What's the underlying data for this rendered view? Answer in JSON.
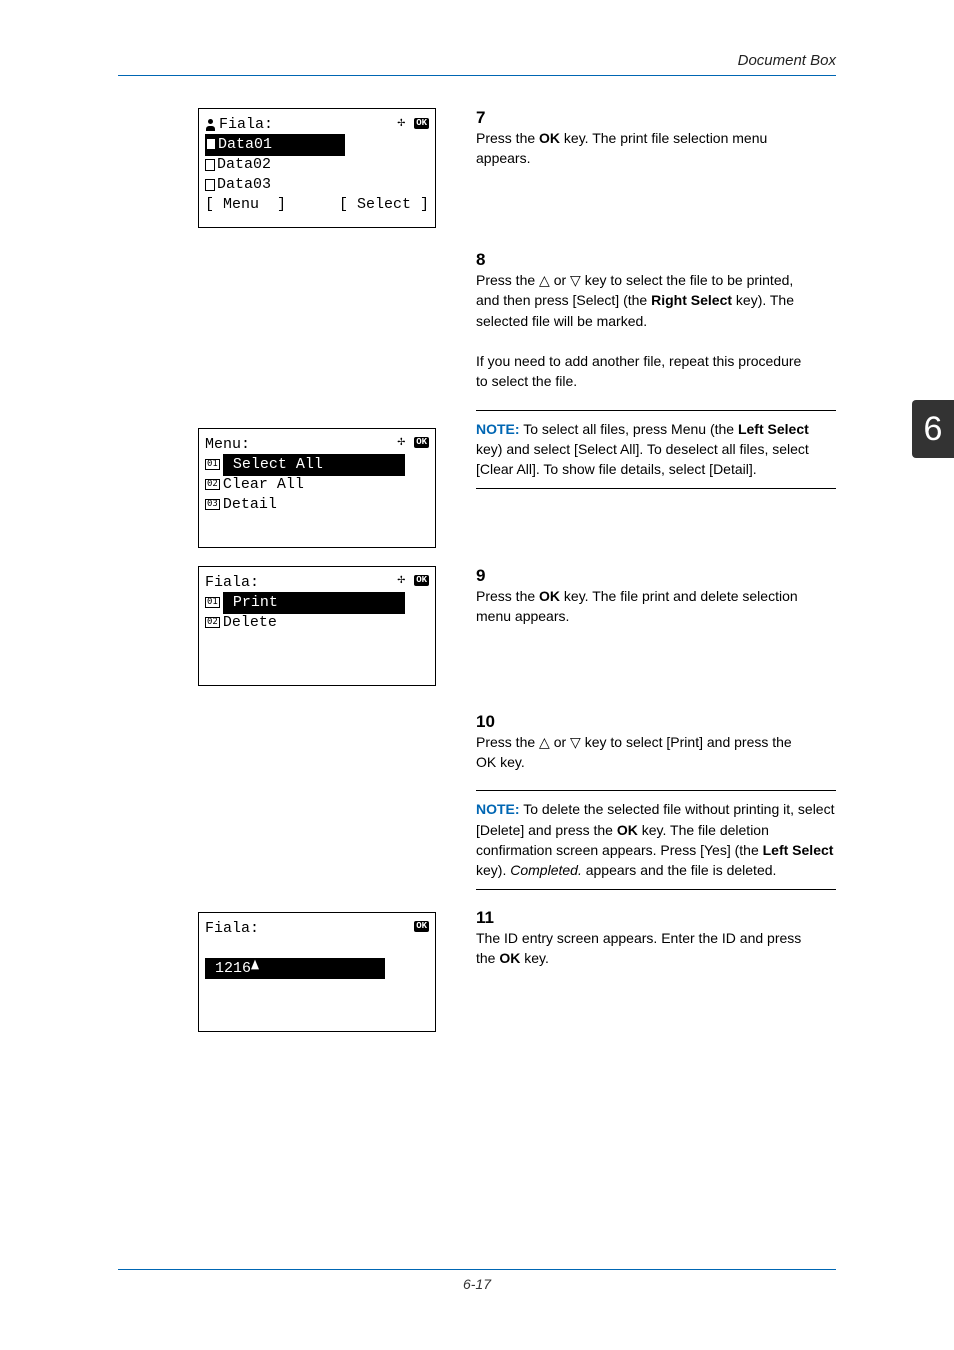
{
  "header": {
    "title": "Document Box"
  },
  "footer": {
    "page": "6-17"
  },
  "tab": {
    "num": "6"
  },
  "screens": {
    "s1": {
      "title": "Fiala:",
      "lines": [
        "Data01",
        "Data02",
        "Data03"
      ],
      "footer_left": "[ Menu  ]",
      "footer_right": "[ Select ]"
    },
    "s2": {
      "title": "Menu:",
      "items": [
        {
          "n": "1",
          "label": "Select All"
        },
        {
          "n": "2",
          "label": "Clear All"
        },
        {
          "n": "3",
          "label": "Detail"
        }
      ]
    },
    "s3": {
      "title": "Fiala:",
      "items": [
        {
          "n": "1",
          "label": "Print"
        },
        {
          "n": "2",
          "label": "Delete"
        }
      ]
    },
    "s4": {
      "title": "Fiala:",
      "value": "1216"
    }
  },
  "steps": {
    "s7": {
      "n": "7",
      "t1": "Press the ",
      "b1": "OK",
      "t2": " key. The print file selection menu appears."
    },
    "s8": {
      "n": "8",
      "t1": "Press the ",
      "t2": " or ",
      "t3": " key to select the file to be printed, and then press [Select] (the ",
      "b1": "Right Select",
      "t4": " key). The selected file will be marked.",
      "para2": "If you need to add another file, repeat this procedure to select the file."
    },
    "s9": {
      "n": "9",
      "t1": "Press the ",
      "b1": "OK",
      "t2": " key. The file print and delete selection menu appears."
    },
    "s10": {
      "n": "10",
      "t1": "Press the ",
      "t2": " or ",
      "t3": " key to select [Print] and press the OK key."
    },
    "s11": {
      "n": "11",
      "t1": "The ID entry screen appears. Enter the ID and press the ",
      "b1": "OK",
      "t2": " key."
    }
  },
  "notes": {
    "n1": {
      "label": "NOTE:",
      "t1": " To select all files, press Menu (the ",
      "b1": "Left Select",
      "t2": " key) and select [Select All]. To deselect all files, select [Clear All]. To show file details, select [Detail]."
    },
    "n2": {
      "label": "NOTE:",
      "t1": " To delete the selected file without printing it, select [Delete] and press the ",
      "b1": "OK",
      "t2": " key. The file deletion confirmation screen appears. Press [Yes] (the ",
      "b2": "Left Select",
      "t3": " key). ",
      "i1": "Completed.",
      "t4": " appears and the file is deleted."
    }
  }
}
